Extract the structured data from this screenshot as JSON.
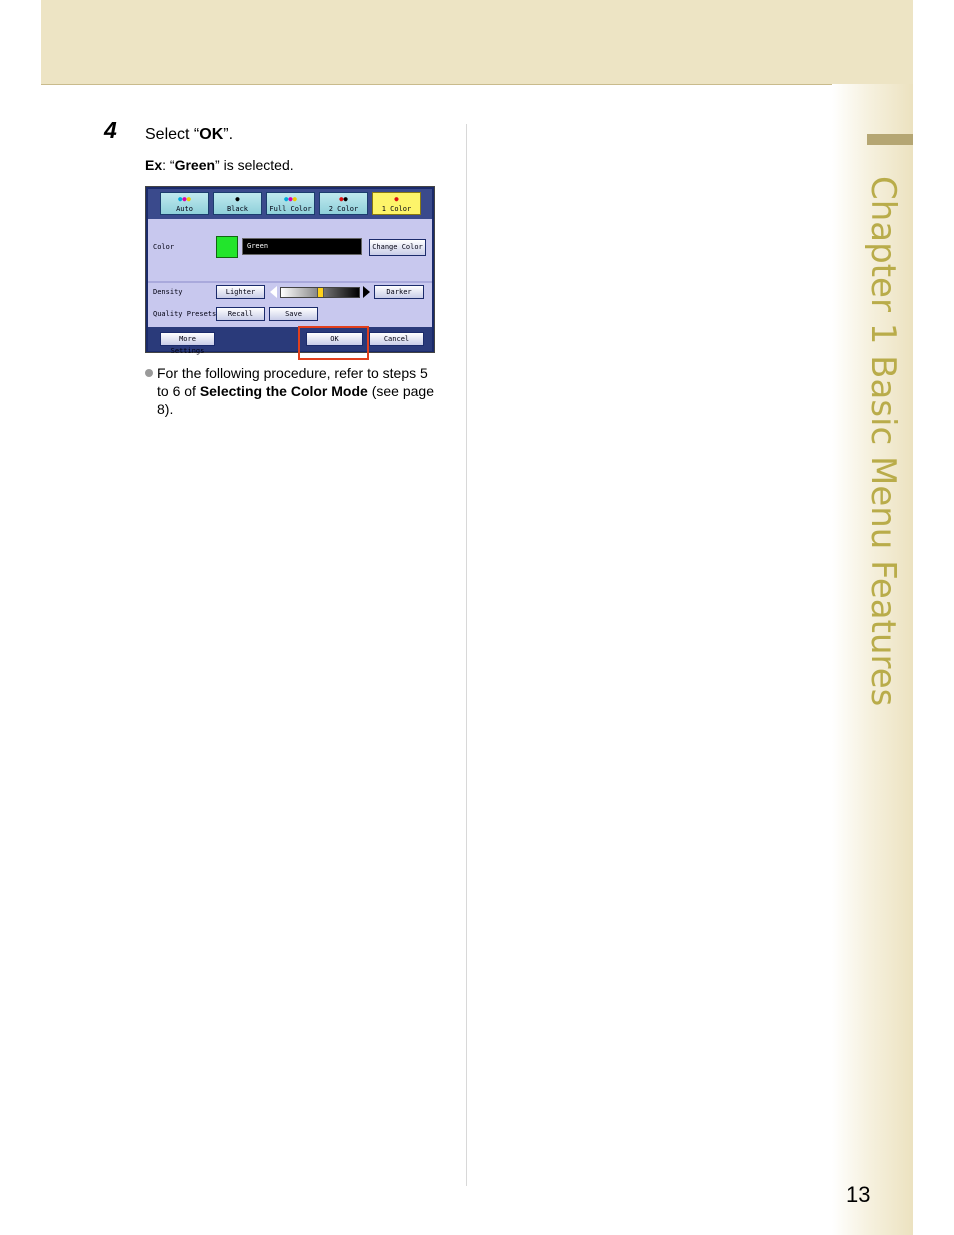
{
  "sidebar": {
    "chapter_label": "Chapter 1    Basic Menu Features"
  },
  "page_number": "13",
  "step": {
    "number": "4",
    "prefix": "Select “",
    "target": "OK",
    "suffix": "”."
  },
  "example": {
    "label": "Ex",
    "prefix": ": “",
    "value": "Green",
    "suffix": "” is selected."
  },
  "screen": {
    "modes": [
      {
        "label": "Auto",
        "icon": "multicolor-dots-icon"
      },
      {
        "label": "Black",
        "icon": "black-dot-icon"
      },
      {
        "label": "Full Color",
        "icon": "multicolor-dots-icon"
      },
      {
        "label": "2 Color",
        "icon": "two-color-dots-icon"
      },
      {
        "label": "1 Color",
        "icon": "red-dot-icon",
        "selected": true
      }
    ],
    "color_label": "Color",
    "color_value": "Green",
    "swatch_color": "#22e52c",
    "change_color_button": "Change Color",
    "density_label": "Density",
    "lighter_button": "Lighter",
    "darker_button": "Darker",
    "density_level": 0.5,
    "quality_presets_label": "Quality Presets",
    "recall_button": "Recall",
    "save_button": "Save",
    "more_settings_button": "More Settings",
    "ok_button": "OK",
    "cancel_button": "Cancel",
    "highlight_color": "#e2401d"
  },
  "note": {
    "line1": "For the following procedure, refer to steps 5",
    "line2_prefix": "to 6 of ",
    "line2_bold": "Selecting the Color Mode",
    "line2_suffix": " (see page",
    "line3": "8)."
  }
}
